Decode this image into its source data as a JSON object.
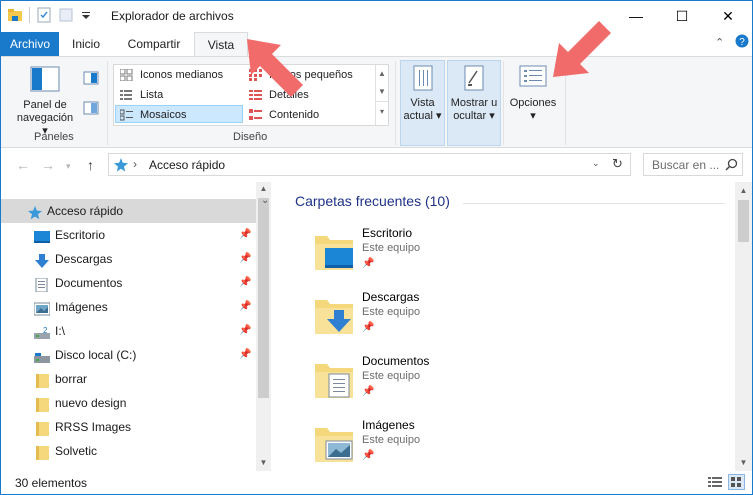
{
  "window": {
    "title": "Explorador de archivos",
    "controls": {
      "minimize": "—",
      "maximize": "☐",
      "close": "✕"
    }
  },
  "tabs": [
    {
      "label": "Archivo"
    },
    {
      "label": "Inicio"
    },
    {
      "label": "Compartir"
    },
    {
      "label": "Vista"
    }
  ],
  "ribbon": {
    "panes_group": {
      "nav_pane_line1": "Panel de",
      "nav_pane_line2": "navegación",
      "label": "Paneles"
    },
    "layout_group": {
      "items": [
        {
          "label": "Iconos medianos"
        },
        {
          "label": "Iconos pequeños"
        },
        {
          "label": "Lista"
        },
        {
          "label": "Detalles"
        },
        {
          "label": "Mosaicos"
        },
        {
          "label": "Contenido"
        }
      ],
      "selected": "Mosaicos",
      "label": "Diseño"
    },
    "current_view": {
      "line1": "Vista",
      "line2": "actual"
    },
    "show_hide": {
      "line1": "Mostrar u",
      "line2": "ocultar"
    },
    "options": {
      "label": "Opciones"
    }
  },
  "address": {
    "path": "Acceso rápido",
    "search_placeholder": "Buscar en ..."
  },
  "nav": {
    "items": [
      {
        "label": "Acceso rápido",
        "pinned": false
      },
      {
        "label": "Escritorio",
        "pinned": true
      },
      {
        "label": "Descargas",
        "pinned": true
      },
      {
        "label": "Documentos",
        "pinned": true
      },
      {
        "label": "Imágenes",
        "pinned": true
      },
      {
        "label": "I:\\",
        "pinned": true
      },
      {
        "label": "Disco local (C:)",
        "pinned": true
      },
      {
        "label": "borrar",
        "pinned": false
      },
      {
        "label": "nuevo design",
        "pinned": false
      },
      {
        "label": "RRSS Images",
        "pinned": false
      },
      {
        "label": "Solvetic",
        "pinned": false
      }
    ]
  },
  "content": {
    "section_title": "Carpetas frecuentes (10)",
    "tiles": [
      {
        "name": "Escritorio",
        "location": "Este equipo"
      },
      {
        "name": "Descargas",
        "location": "Este equipo"
      },
      {
        "name": "Documentos",
        "location": "Este equipo"
      },
      {
        "name": "Imágenes",
        "location": "Este equipo"
      }
    ]
  },
  "status": {
    "count": "30 elementos"
  },
  "colors": {
    "accent": "#1979ca",
    "selection": "#cce8ff",
    "folder": "#f5d77c",
    "annotation_arrow": "#f26b6b"
  }
}
